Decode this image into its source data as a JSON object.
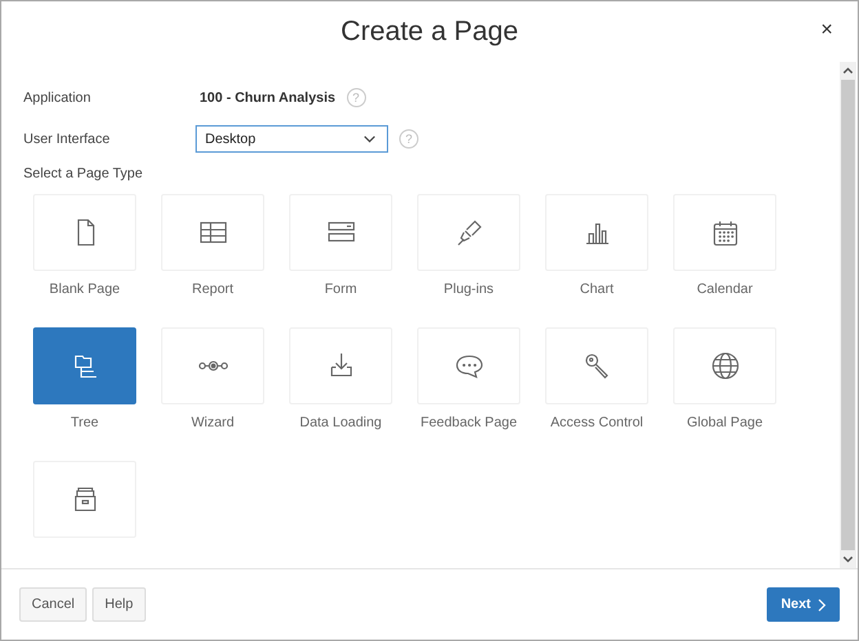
{
  "dialog": {
    "title": "Create a Page",
    "close": "×"
  },
  "fields": [
    {
      "label": "Application",
      "value": "100 - Churn Analysis",
      "kind": "text",
      "help": "?"
    },
    {
      "label": "User Interface",
      "value": "Desktop",
      "kind": "select",
      "help": "?"
    }
  ],
  "page_type_label": "Select a Page Type",
  "page_types": [
    {
      "label": "Blank Page",
      "selected": false
    },
    {
      "label": "Report",
      "selected": false
    },
    {
      "label": "Form",
      "selected": false
    },
    {
      "label": "Plug-ins",
      "selected": false
    },
    {
      "label": "Chart",
      "selected": false
    },
    {
      "label": "Calendar",
      "selected": false
    },
    {
      "label": "Tree",
      "selected": true
    },
    {
      "label": "Wizard",
      "selected": false
    },
    {
      "label": "Data Loading",
      "selected": false
    },
    {
      "label": "Feedback Page",
      "selected": false
    },
    {
      "label": "Access Control",
      "selected": false
    },
    {
      "label": "Global Page",
      "selected": false
    },
    {
      "selected": false
    }
  ],
  "buttons": [
    {
      "label": "Cancel",
      "kind": "secondary"
    },
    {
      "label": "Help",
      "kind": "secondary"
    },
    {
      "label": "Next",
      "kind": "primary"
    }
  ]
}
